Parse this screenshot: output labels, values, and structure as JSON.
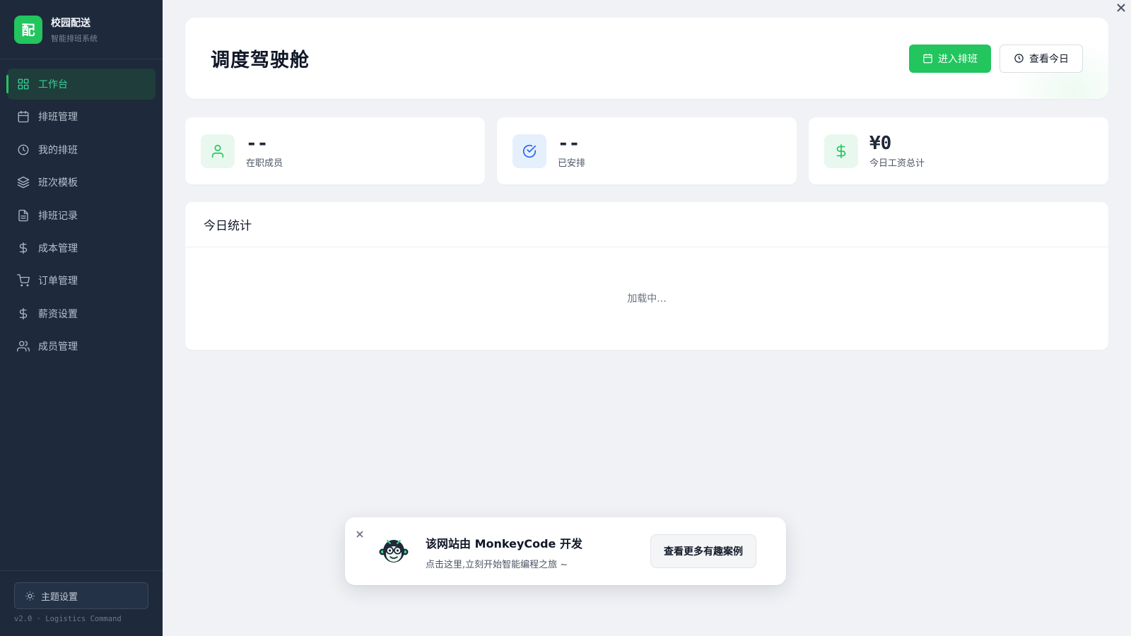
{
  "brand": {
    "logo_char": "配",
    "name": "校园配送",
    "subtitle": "智能排班系统"
  },
  "nav": {
    "items": [
      {
        "label": "工作台",
        "icon": "grid-icon",
        "active": true
      },
      {
        "label": "排班管理",
        "icon": "calendar-icon",
        "active": false
      },
      {
        "label": "我的排班",
        "icon": "clock-icon",
        "active": false
      },
      {
        "label": "班次模板",
        "icon": "layers-icon",
        "active": false
      },
      {
        "label": "排班记录",
        "icon": "document-icon",
        "active": false
      },
      {
        "label": "成本管理",
        "icon": "dollar-icon",
        "active": false
      },
      {
        "label": "订单管理",
        "icon": "cart-icon",
        "active": false
      },
      {
        "label": "薪资设置",
        "icon": "dollar-icon",
        "active": false
      },
      {
        "label": "成员管理",
        "icon": "users-icon",
        "active": false
      }
    ]
  },
  "footer": {
    "theme_label": "主题设置",
    "version": "v2.0 · Logistics Command"
  },
  "header": {
    "title": "调度驾驶舱",
    "primary_button": "进入排班",
    "secondary_button": "查看今日"
  },
  "stats": [
    {
      "value": "--",
      "label": "在职成员",
      "icon": "user-icon"
    },
    {
      "value": "--",
      "label": "已安排",
      "icon": "check-circle-icon"
    },
    {
      "value": "¥0",
      "label": "今日工资总计",
      "icon": "dollar-icon"
    }
  ],
  "today_panel": {
    "title": "今日统计",
    "loading_text": "加载中..."
  },
  "promo": {
    "title": "该网站由 MonkeyCode 开发",
    "subtitle": "点击这里,立刻开始智能编程之旅 ~",
    "button": "查看更多有趣案例"
  },
  "colors": {
    "accent": "#22c55e",
    "sidebar_bg": "#1e293b",
    "page_bg": "#f0f2f6",
    "active_text": "#34d399"
  }
}
